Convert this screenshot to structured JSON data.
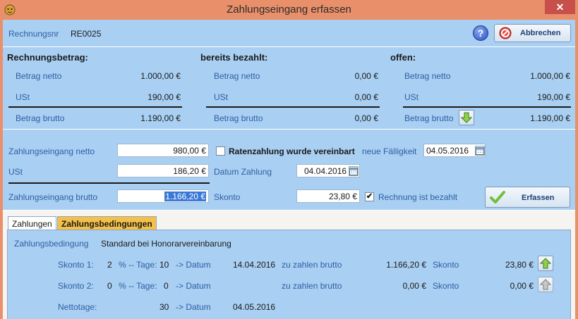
{
  "window": {
    "title": "Zahlungseingang erfassen",
    "close": "✕"
  },
  "header": {
    "rechnungsnr_label": "Rechnungsnr",
    "rechnungsnr_value": "RE0025",
    "help": "?",
    "cancel_label": "Abbrechen"
  },
  "summary": {
    "col1": {
      "title": "Rechnungsbetrag:",
      "netto_label": "Betrag netto",
      "netto": "1.000,00 €",
      "ust_label": "USt",
      "ust": "190,00 €",
      "brutto_label": "Betrag brutto",
      "brutto": "1.190,00 €"
    },
    "col2": {
      "title": "bereits bezahlt:",
      "netto_label": "Betrag netto",
      "netto": "0,00 €",
      "ust_label": "USt",
      "ust": "0,00 €",
      "brutto_label": "Betrag brutto",
      "brutto": "0,00 €"
    },
    "col3": {
      "title": "offen:",
      "netto_label": "Betrag netto",
      "netto": "1.000,00 €",
      "ust_label": "USt",
      "ust": "190,00 €",
      "brutto_label": "Betrag brutto",
      "brutto": "1.190,00 €"
    }
  },
  "entry": {
    "netto_label": "Zahlungseingang netto",
    "netto": "980,00 €",
    "ust_label": "USt",
    "ust": "186,20 €",
    "brutto_label": "Zahlungseingang brutto",
    "brutto": "1.166,20 €",
    "raten_label": "Ratenzahlung wurde vereinbart",
    "faelligkeit_label": "neue Fälligkeit",
    "faelligkeit": "04.05.2016",
    "datum_label": "Datum Zahlung",
    "datum": "04.04.2016",
    "skonto_label": "Skonto",
    "skonto": "23,80 €",
    "bezahlt_label": "Rechnung ist bezahlt",
    "bezahlt_checked": true,
    "erfassen_label": "Erfassen"
  },
  "tabs": [
    {
      "label": "Zahlungen"
    },
    {
      "label": "Zahlungsbedingungen"
    }
  ],
  "conditions": {
    "bedingung_label": "Zahlungsbedingung",
    "bedingung_value": "Standard bei Honorarvereinbarung",
    "rows": [
      {
        "label": "Skonto 1:",
        "pct": "2",
        "pct_sep": "% -- Tage:",
        "days": "10",
        "arrow": "-> Datum",
        "date": "14.04.2016",
        "zahlen_label": "zu zahlen brutto",
        "zahlen": "1.166,20 €",
        "skonto_label": "Skonto",
        "skonto": "23,80 €"
      },
      {
        "label": "Skonto 2:",
        "pct": "0",
        "pct_sep": "% -- Tage:",
        "days": "0",
        "arrow": "-> Datum",
        "date": "",
        "zahlen_label": "zu zahlen brutto",
        "zahlen": "0,00 €",
        "skonto_label": "Skonto",
        "skonto": "0,00 €"
      }
    ],
    "netto": {
      "label": "Nettotage:",
      "days": "30",
      "arrow": "-> Datum",
      "date": "04.05.2016"
    }
  },
  "colors": {
    "panel": "#a9cff2",
    "titlebar": "#e9906a",
    "label": "#2d5fa3",
    "active_tab": "#f5c04a",
    "close": "#c7504a"
  },
  "icons": [
    "app-icon",
    "help-icon",
    "cancel-icon",
    "arrow-down-icon",
    "calendar-icon",
    "checkmark-icon",
    "arrow-up-icon"
  ]
}
